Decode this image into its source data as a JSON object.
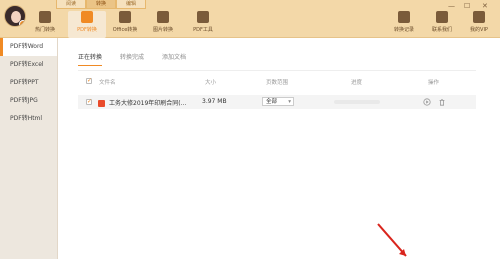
{
  "topbar": {
    "tabs": [
      {
        "label": "阅读"
      },
      {
        "label": "转换"
      },
      {
        "label": "编辑"
      }
    ],
    "tools": [
      {
        "label": "热门转换",
        "icon": "star-icon"
      },
      {
        "label": "PDF转换",
        "icon": "pdf-convert-icon"
      },
      {
        "label": "Office转换",
        "icon": "office-icon"
      },
      {
        "label": "图片转换",
        "icon": "image-icon"
      },
      {
        "label": "PDF工具",
        "icon": "briefcase-icon"
      }
    ],
    "right_tools": [
      {
        "label": "转换记录",
        "icon": "history-icon"
      },
      {
        "label": "联系我们",
        "icon": "support-icon"
      },
      {
        "label": "我的VIP",
        "icon": "crown-icon"
      }
    ],
    "window_controls": [
      "—",
      "☐",
      "✕"
    ]
  },
  "sidebar": {
    "items": [
      {
        "label": "PDF转Word"
      },
      {
        "label": "PDF转Excel"
      },
      {
        "label": "PDF转PPT"
      },
      {
        "label": "PDF转JPG"
      },
      {
        "label": "PDF转Html"
      }
    ]
  },
  "main": {
    "subtabs": [
      {
        "label": "正在转换"
      },
      {
        "label": "转换完成"
      },
      {
        "label": "添加文档"
      }
    ],
    "table": {
      "headers": {
        "filename": "文件名",
        "size": "大小",
        "page_range": "页数范围",
        "progress": "进度",
        "actions": "操作"
      },
      "rows": [
        {
          "filename": "工务大修2019年印刷合同(...",
          "size": "3.97 MB",
          "page_range": "全部",
          "progress": 0
        }
      ]
    }
  },
  "colors": {
    "accent": "#F08A24",
    "topbar": "#F3D8A8",
    "sidebar": "#EDE7DE",
    "annotation_arrow": "#D9251D"
  }
}
